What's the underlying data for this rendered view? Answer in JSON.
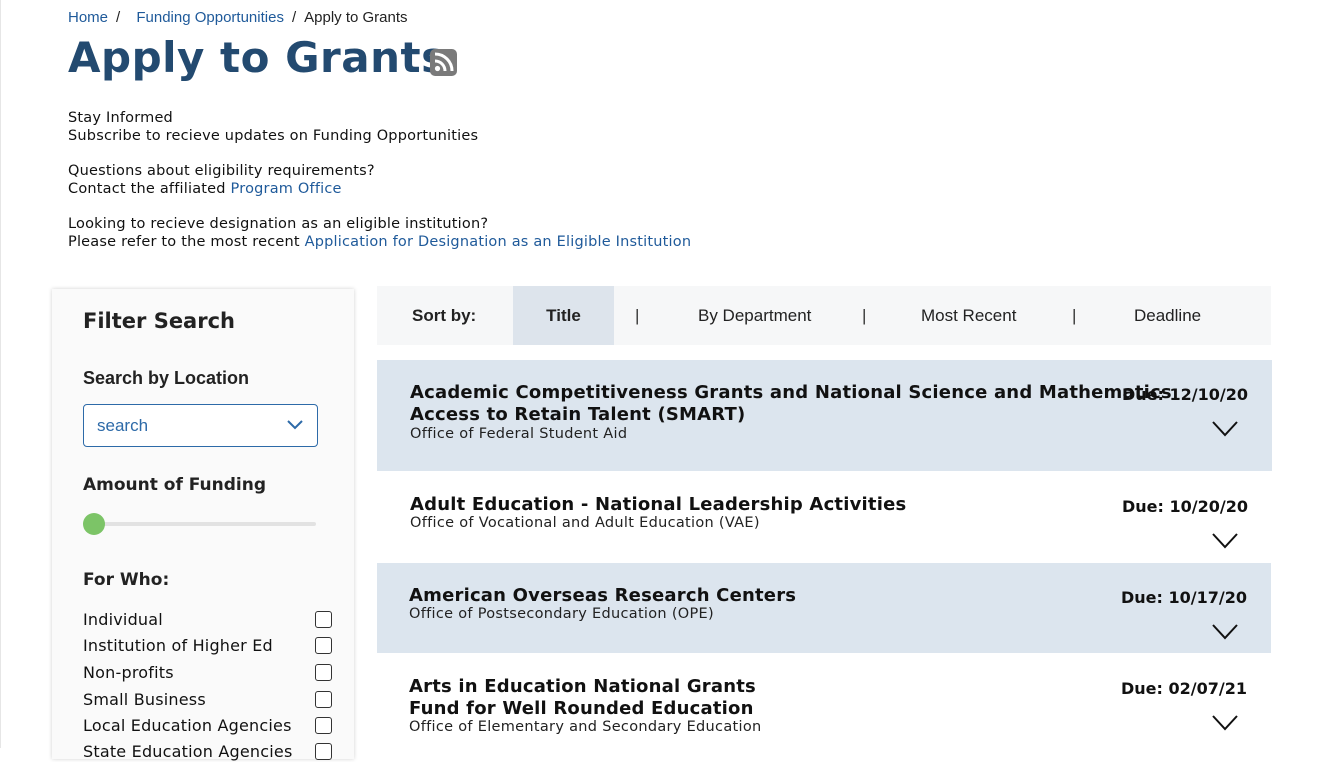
{
  "breadcrumb": {
    "home": "Home",
    "sep1": "/",
    "funding": "Funding Opportunities",
    "sep2": "/",
    "current": "Apply to Grants"
  },
  "page": {
    "title": "Apply to Grants",
    "rss_icon": "rss-icon"
  },
  "info": {
    "stay_informed": "Stay Informed",
    "subscribe": "Subscribe to recieve updates on Funding Opportunities",
    "questions": "Questions about eligibility requirements?",
    "contact_prefix": "Contact the affiliated",
    "contact_link": "Program Office",
    "designation_q": "Looking to recieve designation as an eligible institution?",
    "designation_prefix": "Please refer to the most recent",
    "designation_link": "Application for Designation as an Eligible Institution"
  },
  "filter": {
    "title": "Filter Search",
    "location_label": "Search by Location",
    "search_placeholder": "search",
    "funding_label": "Amount of Funding",
    "funding_value": 0,
    "who_label": "For Who:",
    "who_options": [
      "Individual",
      "Institution of Higher Ed",
      "Non-profits",
      "Small Business",
      "Local Education Agencies",
      "State Education Agencies"
    ]
  },
  "sort": {
    "label": "Sort by:",
    "options": [
      "Title",
      "By Department",
      "Most Recent",
      "Deadline"
    ],
    "separator": "|",
    "active": "Title"
  },
  "grants": [
    {
      "title_lines": [
        "Academic Competitiveness Grants and National Science and Mathematics",
        "Access to Retain Talent (SMART)"
      ],
      "office": "Office of Federal Student Aid",
      "due": "Due: 12/10/20"
    },
    {
      "title_lines": [
        "Adult Education - National Leadership Activities"
      ],
      "office": "Office of Vocational and Adult Education (VAE)",
      "due": "Due: 10/20/20"
    },
    {
      "title_lines": [
        "American Overseas Research Centers"
      ],
      "office": "Office of Postsecondary Education (OPE)",
      "due": "Due: 10/17/20"
    },
    {
      "title_lines": [
        "Arts in Education National Grants",
        "Fund for Well Rounded Education"
      ],
      "office": "Office of Elementary and Secondary Education",
      "due": "Due: 02/07/21"
    }
  ],
  "colors": {
    "title": "#234a70",
    "link": "#1f5a9a",
    "shaded_row": "#dce5ee",
    "slider_thumb": "#7cc467"
  }
}
